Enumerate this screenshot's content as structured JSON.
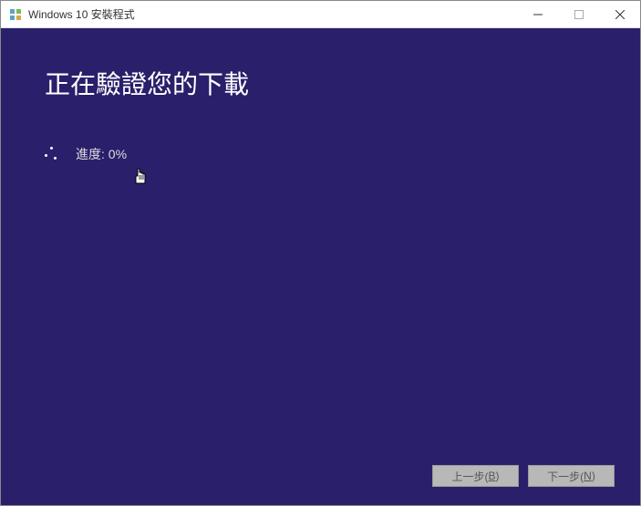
{
  "titlebar": {
    "title": "Windows 10 安裝程式"
  },
  "main": {
    "heading": "正在驗證您的下載",
    "progress_label": "進度: 0%"
  },
  "footer": {
    "back_label": "上一步(",
    "back_hotkey": "B",
    "back_close": ")",
    "next_label": "下一步(",
    "next_hotkey": "N",
    "next_close": ")"
  }
}
